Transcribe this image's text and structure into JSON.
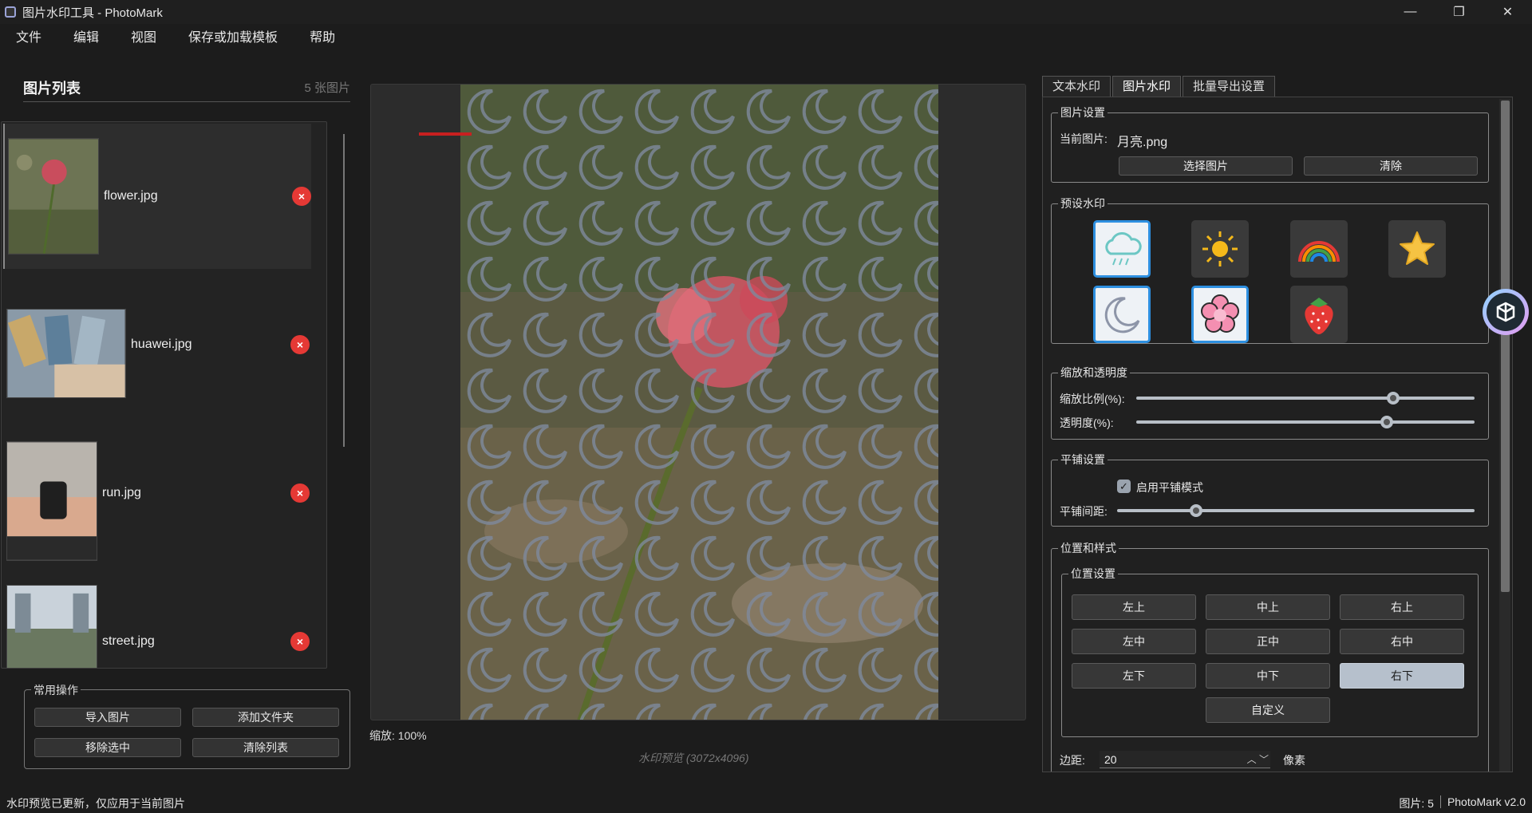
{
  "window": {
    "title": "图片水印工具 - PhotoMark"
  },
  "menu": [
    "文件",
    "编辑",
    "视图",
    "保存或加载模板",
    "帮助"
  ],
  "image_list": {
    "title": "图片列表",
    "count": "5 张图片",
    "items": [
      {
        "name": "flower.jpg",
        "selected": true
      },
      {
        "name": "huawei.jpg",
        "selected": false
      },
      {
        "name": "run.jpg",
        "selected": false
      },
      {
        "name": "street.jpg",
        "selected": false
      }
    ],
    "delete_glyph": "×"
  },
  "common_ops": {
    "title": "常用操作",
    "import": "导入图片",
    "add_folder": "添加文件夹",
    "remove_selected": "移除选中",
    "clear_list": "清除列表"
  },
  "preview": {
    "zoom": "缩放: 100%",
    "caption": "水印预览 (3072x4096)"
  },
  "tabs": [
    "文本水印",
    "图片水印",
    "批量导出设置"
  ],
  "active_tab": "图片水印",
  "image_settings": {
    "title": "图片设置",
    "current_label": "当前图片:",
    "current_value": "月亮.png",
    "choose": "选择图片",
    "clear": "清除"
  },
  "presets": {
    "title": "预设水印",
    "items": [
      {
        "icon": "rain-cloud-icon",
        "selected": true
      },
      {
        "icon": "sun-icon",
        "selected": false
      },
      {
        "icon": "rainbow-icon",
        "selected": false
      },
      {
        "icon": "star-icon",
        "selected": false
      },
      {
        "icon": "moon-icon",
        "selected": true
      },
      {
        "icon": "flower-icon",
        "selected": true
      },
      {
        "icon": "strawberry-icon",
        "selected": false
      }
    ]
  },
  "scale_opacity": {
    "title": "缩放和透明度",
    "scale_label": "缩放比例(%):",
    "scale_value": 0.76,
    "opacity_label": "透明度(%):",
    "opacity_value": 0.74
  },
  "tile": {
    "title": "平铺设置",
    "enable_label": "启用平铺模式",
    "enabled": true,
    "spacing_label": "平铺间距:",
    "spacing_value": 0.22
  },
  "position_style": {
    "title": "位置和样式",
    "pos_title": "位置设置",
    "positions": [
      "左上",
      "中上",
      "右上",
      "左中",
      "正中",
      "右中",
      "左下",
      "中下",
      "右下"
    ],
    "active_position": "右下",
    "custom": "自定义",
    "margin_label": "边距:",
    "margin_value": "20",
    "margin_unit": "像素"
  },
  "status": {
    "message": "水印预览已更新，仅应用于当前图片",
    "images": "图片: 5",
    "version": "PhotoMark v2.0"
  }
}
